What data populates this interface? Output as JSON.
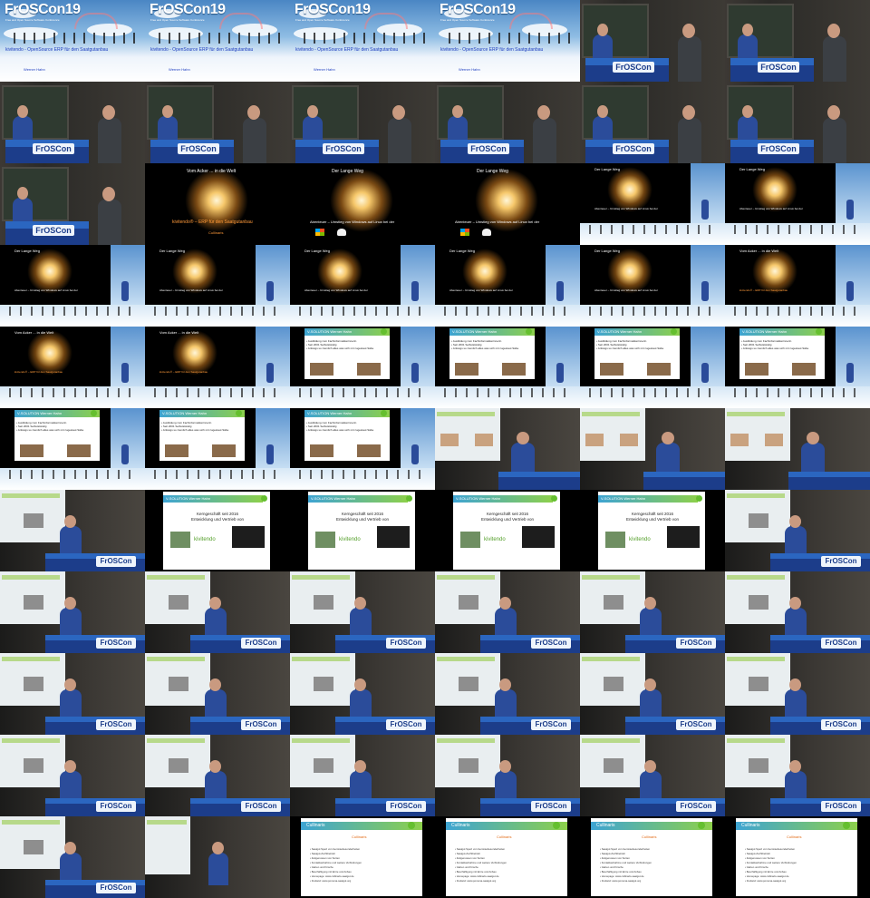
{
  "thumbnails": {
    "columns": 6,
    "rows": 11,
    "cells": [
      "title",
      "title",
      "title",
      "title",
      "speaker",
      "speaker",
      "speaker",
      "speaker",
      "speaker",
      "speaker",
      "speaker",
      "speaker",
      "speaker",
      "dark-start",
      "dark-linux",
      "dark-linux",
      "comp-linux",
      "comp-linux",
      "comp-linux",
      "comp-linux",
      "comp-linux",
      "comp-linux",
      "comp-linux",
      "comp-kivitendo",
      "comp-kivitendo",
      "comp-kivitendo",
      "comp-vsol-photo",
      "comp-vsol",
      "comp-vsol",
      "comp-vsol",
      "comp-vsol",
      "comp-vsol",
      "comp-vsol",
      "proj-photo",
      "proj-photo",
      "proj-photo",
      "proj",
      "vsol-slide",
      "vsol-slide",
      "vsol-slide",
      "vsol-slide",
      "proj",
      "proj",
      "proj",
      "proj",
      "proj",
      "proj",
      "proj",
      "proj",
      "proj",
      "proj",
      "proj",
      "proj",
      "proj",
      "proj",
      "proj",
      "proj",
      "proj",
      "proj",
      "proj",
      "proj",
      "proj-bright",
      "cullinaris",
      "cullinaris",
      "cullinaris",
      "cullinaris"
    ]
  },
  "title_slide": {
    "logo": "FrOSCon19",
    "tagline": "Free and Open Source Software Conference",
    "title": "kivitendo - OpenSource ERP für den Saatgutanbau",
    "speaker": "Werner Hahn"
  },
  "stage": {
    "lectern_logo": "FrOSCon"
  },
  "slides": {
    "start_caption": "Vom Acker ... in die Welt",
    "long_way": "Der Lange Weg",
    "kivitendo_line": "kivitendo®  –  ERP für den Saatgutanbau",
    "linux_line": "Abenteuer – Umstieg von Windows auf Linux bei der",
    "cullinaris_small": "Cullinaris",
    "vsol_header": "V-SOLUTION Werner Hahn",
    "vsol_bullets": "• Ausbildung zum Fachinformatikerinnerin\n• Seit 2001 Selbstständig\n• Anfangs so ziemlich alles was sich mit zugestaut Säbe",
    "vsol_body": "Kerngeschäft seit 2016\nEntwicklung und Vertrieb von",
    "vsol_brand": "kivitendo",
    "cullinaris_header": "Cullinaris",
    "cullinaris_brand": "Cullinaris",
    "cullinaris_list": "• Saatgut Spezi von Gemüsebesonderheiten\n• Saatgut-Zuchtbetrieb\n• Zeitgenossen von Sorten\n• Kontaktaufnahme und weitere Verbindungen\n• Gärten und Kirsche\n• Beschäftigung mit Ernte und Anbau\n• Homepage: www.cullinaris-saatgut.de\n• Freiland: www.pomona-saatgut.org"
  },
  "colors": {
    "sky_top": "#4a86c4",
    "froscon_blue": "#1c3d8a",
    "slide_title_blue": "#2140c0",
    "accent_orange": "#ff9a3a",
    "accent_green": "#8dd04b"
  }
}
